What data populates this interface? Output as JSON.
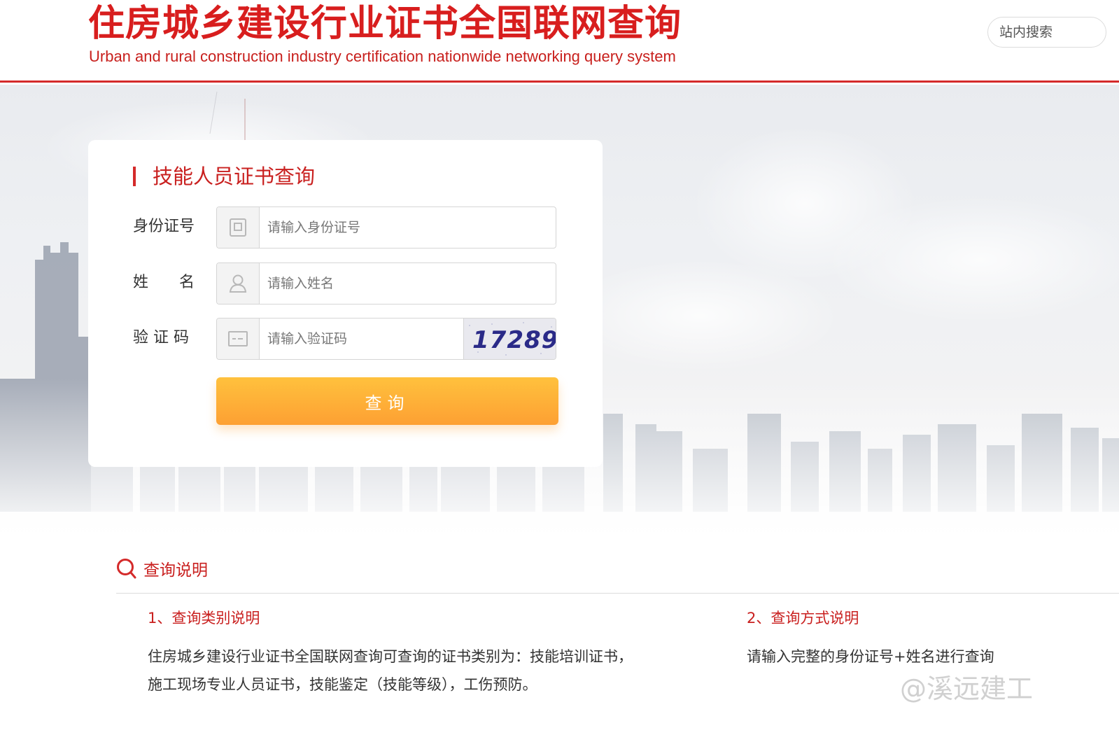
{
  "header": {
    "title_cn": "住房城乡建设行业证书全国联网查询",
    "title_en": "Urban and rural construction industry certification nationwide networking query system",
    "site_search_placeholder": "站内搜索"
  },
  "form": {
    "title": "技能人员证书查询",
    "id_label": "身份证号",
    "id_placeholder": "请输入身份证号",
    "name_label": "姓　　名",
    "name_placeholder": "请输入姓名",
    "captcha_label": "验 证 码",
    "captcha_placeholder": "请输入验证码",
    "captcha_text": "17289",
    "query_button": "查询"
  },
  "instructions": {
    "title": "查询说明",
    "section1": {
      "title": "1、查询类别说明",
      "body": "住房城乡建设行业证书全国联网查询可查询的证书类别为：技能培训证书， 施工现场专业人员证书，技能鉴定（技能等级），工伤预防。"
    },
    "section2": {
      "title": "2、查询方式说明",
      "body": "请输入完整的身份证号+姓名进行查询"
    }
  },
  "watermark": "@溪远建工",
  "colors": {
    "brand_red": "#d81e1e",
    "button_orange": "#fda033"
  }
}
